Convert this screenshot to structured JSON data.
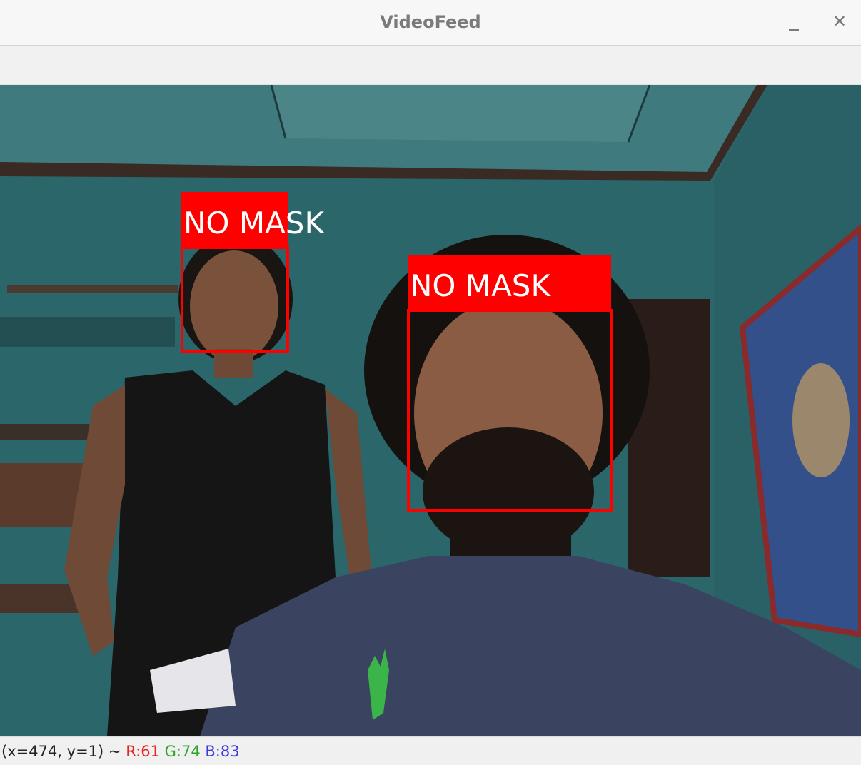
{
  "window": {
    "title": "VideoFeed",
    "minimize_symbol": "–",
    "close_symbol": "✕"
  },
  "detections": [
    {
      "label": "NO MASK",
      "box_color": "#ff0000",
      "text_color": "#ffffff"
    },
    {
      "label": "NO MASK",
      "box_color": "#ff0000",
      "text_color": "#ffffff"
    }
  ],
  "status": {
    "coords": "(x=474, y=1) ~",
    "r": "R:61",
    "g": "G:74",
    "b": "B:83"
  },
  "colors": {
    "wall": "#2f6f74",
    "box": "#ff0000",
    "r_text": "#e0261f",
    "g_text": "#2aa52a",
    "b_text": "#3a3ad8"
  }
}
